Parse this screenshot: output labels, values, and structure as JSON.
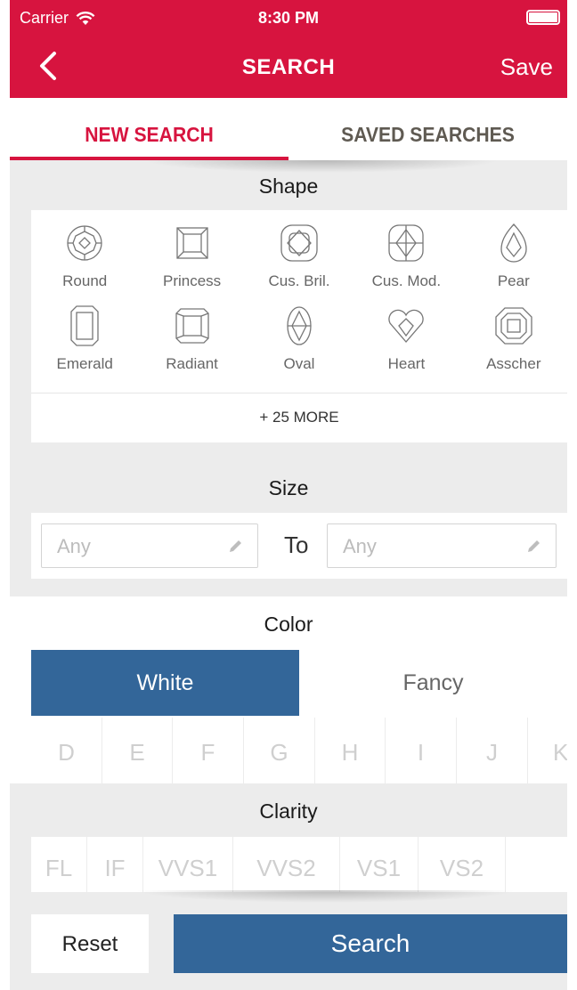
{
  "status_bar": {
    "carrier": "Carrier",
    "time": "8:30 PM"
  },
  "nav": {
    "title": "SEARCH",
    "save_label": "Save"
  },
  "tabs": [
    {
      "label": "NEW SEARCH",
      "active": true
    },
    {
      "label": "SAVED SEARCHES",
      "active": false
    }
  ],
  "shape": {
    "title": "Shape",
    "shapes": [
      {
        "label": "Round",
        "icon": "round-diamond-icon"
      },
      {
        "label": "Princess",
        "icon": "princess-diamond-icon"
      },
      {
        "label": "Cus. Bril.",
        "icon": "cushion-brilliant-diamond-icon"
      },
      {
        "label": "Cus. Mod.",
        "icon": "cushion-modified-diamond-icon"
      },
      {
        "label": "Pear",
        "icon": "pear-diamond-icon"
      },
      {
        "label": "Emerald",
        "icon": "emerald-diamond-icon"
      },
      {
        "label": "Radiant",
        "icon": "radiant-diamond-icon"
      },
      {
        "label": "Oval",
        "icon": "oval-diamond-icon"
      },
      {
        "label": "Heart",
        "icon": "heart-diamond-icon"
      },
      {
        "label": "Asscher",
        "icon": "asscher-diamond-icon"
      }
    ],
    "more_label": "+ 25 MORE"
  },
  "size": {
    "title": "Size",
    "from_placeholder": "Any",
    "to_label": "To",
    "to_placeholder": "Any"
  },
  "color": {
    "title": "Color",
    "toggle": {
      "white": "White",
      "fancy": "Fancy",
      "selected": "White"
    },
    "grades": [
      "D",
      "E",
      "F",
      "G",
      "H",
      "I",
      "J",
      "K"
    ]
  },
  "clarity": {
    "title": "Clarity",
    "grades": [
      "FL",
      "IF",
      "VVS1",
      "VVS2",
      "VS1",
      "VS2"
    ]
  },
  "actions": {
    "reset_label": "Reset",
    "search_label": "Search"
  },
  "colors": {
    "brand_red": "#d7143f",
    "accent_blue": "#336699"
  }
}
